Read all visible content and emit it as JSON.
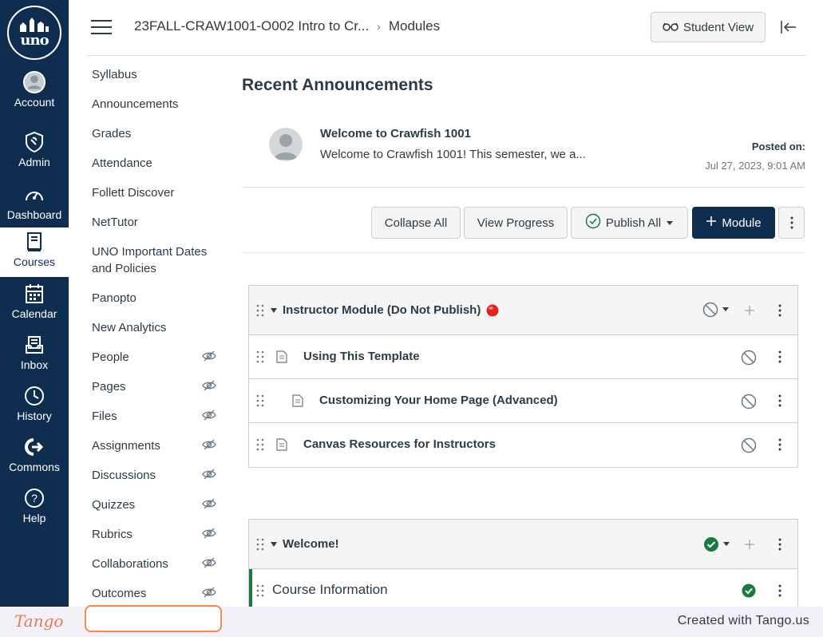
{
  "colors": {
    "nav_bg": "#0f2e4f",
    "primary_button": "#0f2e4f",
    "published_green": "#1b7a3e",
    "unpublished_red": "#e0261c",
    "highlight_orange": "#f28c46",
    "tango_brand": "#e07a5f"
  },
  "global_nav": {
    "logo_text": "uno",
    "items": [
      {
        "label": "Account",
        "icon": "avatar-icon"
      },
      {
        "label": "Admin",
        "icon": "shield-icon"
      },
      {
        "label": "Dashboard",
        "icon": "speedometer-icon"
      },
      {
        "label": "Courses",
        "icon": "book-icon",
        "active": true
      },
      {
        "label": "Calendar",
        "icon": "calendar-icon"
      },
      {
        "label": "Inbox",
        "icon": "inbox-icon"
      },
      {
        "label": "History",
        "icon": "clock-icon"
      },
      {
        "label": "Commons",
        "icon": "commons-icon"
      },
      {
        "label": "Help",
        "icon": "question-icon"
      }
    ]
  },
  "header": {
    "course": "23FALL-CRAW1001-O002 Intro to Cr...",
    "page": "Modules",
    "student_view_label": "Student View"
  },
  "course_nav": {
    "items": [
      {
        "label": "Syllabus",
        "hidden": false
      },
      {
        "label": "Announcements",
        "hidden": false
      },
      {
        "label": "Grades",
        "hidden": false
      },
      {
        "label": "Attendance",
        "hidden": false
      },
      {
        "label": "Follett Discover",
        "hidden": false
      },
      {
        "label": "NetTutor",
        "hidden": false
      },
      {
        "label": "UNO Important Dates and Policies",
        "hidden": false
      },
      {
        "label": "Panopto",
        "hidden": false
      },
      {
        "label": "New Analytics",
        "hidden": false
      },
      {
        "label": "People",
        "hidden": true
      },
      {
        "label": "Pages",
        "hidden": true
      },
      {
        "label": "Files",
        "hidden": true
      },
      {
        "label": "Assignments",
        "hidden": true
      },
      {
        "label": "Discussions",
        "hidden": true
      },
      {
        "label": "Quizzes",
        "hidden": true
      },
      {
        "label": "Rubrics",
        "hidden": true
      },
      {
        "label": "Collaborations",
        "hidden": true
      },
      {
        "label": "Outcomes",
        "hidden": true
      }
    ]
  },
  "announcements": {
    "heading": "Recent Announcements",
    "items": [
      {
        "title": "Welcome to Crawfish 1001",
        "body": "Welcome to Crawfish 1001! This semester, we a...",
        "posted_label": "Posted on:",
        "posted_date": "Jul 27, 2023, 9:01 AM"
      }
    ]
  },
  "toolbar": {
    "collapse_all": "Collapse All",
    "view_progress": "View Progress",
    "publish_all": "Publish All",
    "add_module": "Module"
  },
  "modules": [
    {
      "title": "Instructor Module (Do Not Publish)",
      "status": "unpublished",
      "items": [
        {
          "title": "Using This Template",
          "indent": 0
        },
        {
          "title": "Customizing Your Home Page (Advanced)",
          "indent": 1
        },
        {
          "title": "Canvas Resources for Instructors",
          "indent": 0
        }
      ]
    },
    {
      "title": "Welcome!",
      "status": "published",
      "items": [
        {
          "title": "Course Information",
          "type": "subheader"
        }
      ]
    }
  ],
  "footer": {
    "logo": "Tango",
    "credit": "Created with Tango.us"
  }
}
